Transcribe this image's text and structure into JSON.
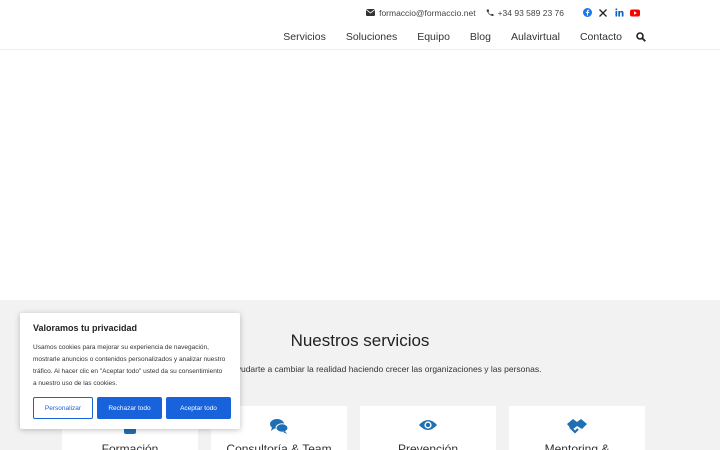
{
  "topbar": {
    "email": "formaccio@formaccio.net",
    "phone": "+34 93 589 23 76",
    "social": [
      "facebook-icon",
      "x-icon",
      "linkedin-icon",
      "youtube-icon"
    ]
  },
  "nav": {
    "items": [
      "Servicios",
      "Soluciones",
      "Equipo",
      "Blog",
      "Aulavirtual",
      "Contacto"
    ]
  },
  "services": {
    "title": "Nuestros servicios",
    "subtitle": "ayudarte a cambiar la realidad haciendo crecer las organizaciones y las personas.",
    "cards": [
      {
        "title": "Formación",
        "icon": "graduation-icon"
      },
      {
        "title": "Consultoría & Team",
        "icon": "chat-bubbles-icon"
      },
      {
        "title": "Prevención",
        "icon": "eye-icon"
      },
      {
        "title": "Mentoring &",
        "icon": "handshake-icon"
      }
    ]
  },
  "cookie": {
    "title": "Valoramos tu privacidad",
    "text": "Usamos cookies para mejorar su experiencia de navegación, mostrarle anuncios o contenidos personalizados y analizar nuestro tráfico. Al hacer clic en \"Aceptar todo\" usted da su consentimiento a nuestro uso de las cookies.",
    "customize": "Personalizar",
    "reject": "Rechazar todo",
    "accept": "Aceptar todo"
  },
  "colors": {
    "accent": "#1863dc",
    "icon_blue": "#1f6fb5",
    "section_bg": "#f2f2f2"
  }
}
